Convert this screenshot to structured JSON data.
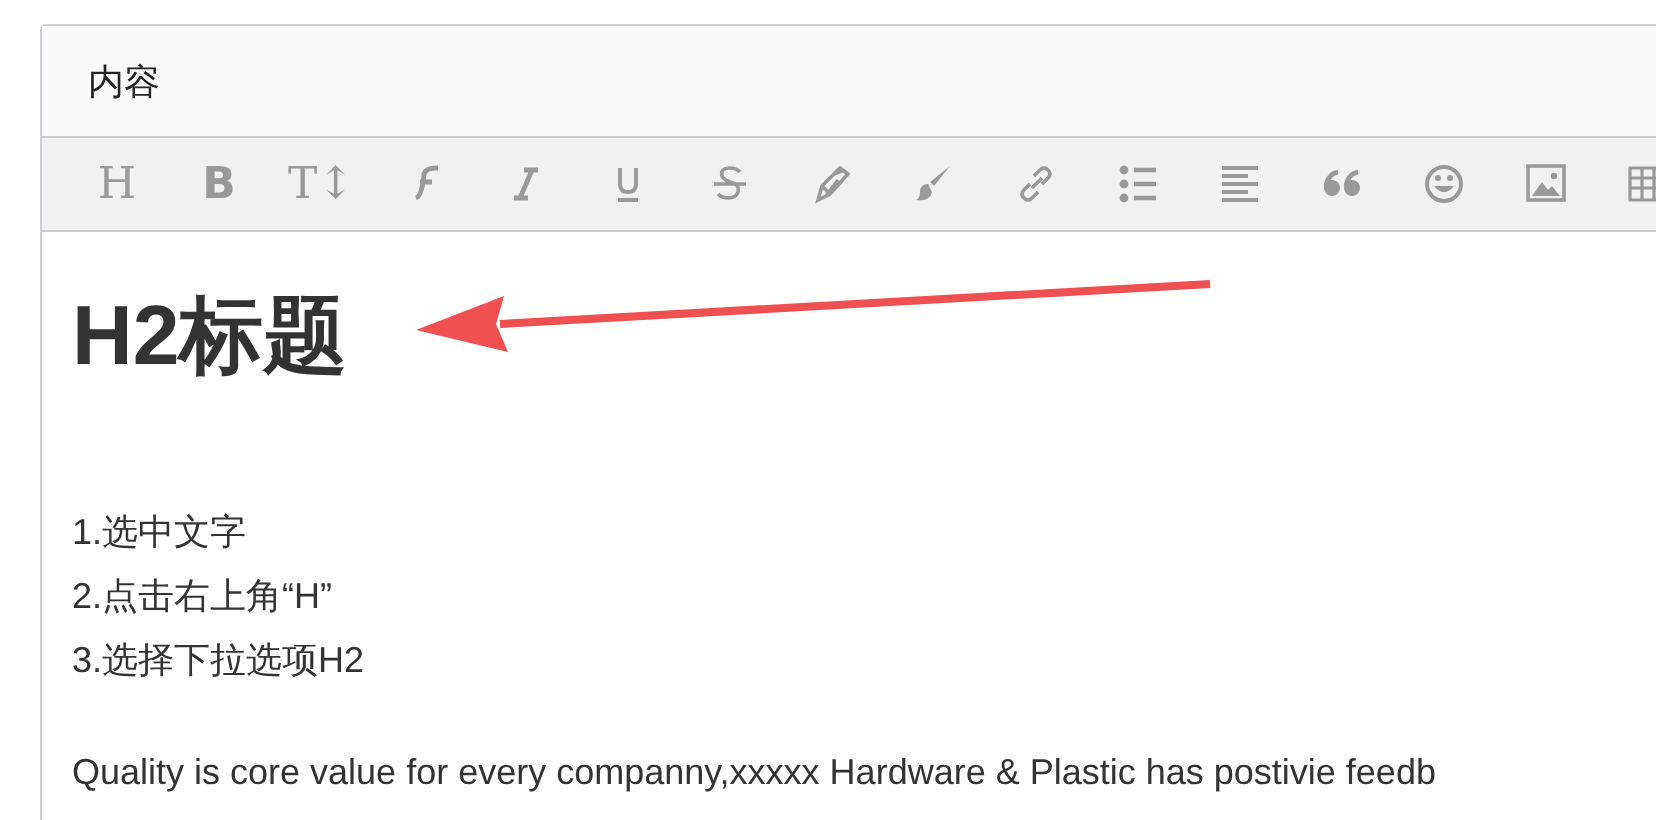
{
  "panel": {
    "title": "内容"
  },
  "toolbar": [
    {
      "kind": "heading",
      "label": "H"
    },
    {
      "kind": "bold",
      "label": "B"
    },
    {
      "kind": "size",
      "label": "T↕"
    },
    {
      "kind": "font"
    },
    {
      "kind": "italic"
    },
    {
      "kind": "underline"
    },
    {
      "kind": "strike"
    },
    {
      "kind": "pen"
    },
    {
      "kind": "brush"
    },
    {
      "kind": "link"
    },
    {
      "kind": "list"
    },
    {
      "kind": "align"
    },
    {
      "kind": "quote"
    },
    {
      "kind": "emoji"
    },
    {
      "kind": "image"
    },
    {
      "kind": "table"
    }
  ],
  "editor": {
    "heading": "H2标题",
    "lines": [
      "1.选中文字",
      "2.点击右上角“H”",
      "3.选择下拉选项H2"
    ],
    "paragraph": "Quality is core value for every companny,xxxxx Hardware & Plastic has postivie feedb"
  }
}
